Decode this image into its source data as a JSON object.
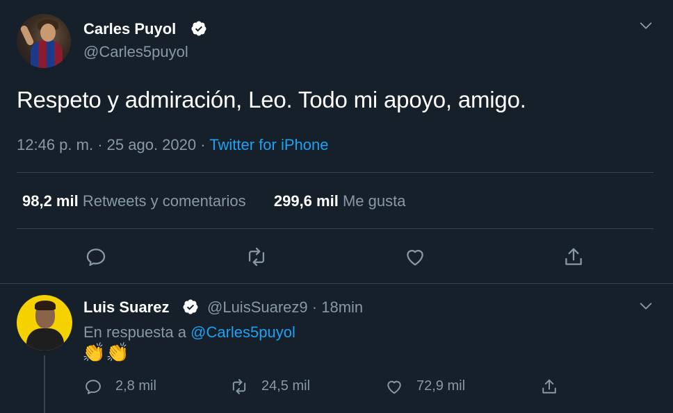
{
  "main_tweet": {
    "author_name": "Carles Puyol",
    "author_handle": "@Carles5puyol",
    "text": "Respeto y admiración, Leo. Todo mi apoyo, amigo.",
    "time": "12:46 p. m.",
    "separator": "·",
    "date": "25 ago. 2020",
    "source": "Twitter for iPhone",
    "retweets_count": "98,2 mil",
    "retweets_label": "Retweets y comentarios",
    "likes_count": "299,6 mil",
    "likes_label": "Me gusta"
  },
  "reply_tweet": {
    "author_name": "Luis Suarez",
    "author_handle": "@LuisSuarez9",
    "separator": "·",
    "time": "18min",
    "replying_prefix": "En respuesta a",
    "replying_to": "@Carles5puyol",
    "emoji_1": "👏",
    "emoji_2": "👏",
    "replies_count": "2,8 mil",
    "retweets_count": "24,5 mil",
    "likes_count": "72,9 mil"
  },
  "icons": {
    "verified": "verified-badge-icon",
    "menu": "chevron-down-icon",
    "reply": "speech-bubble-icon",
    "retweet": "retweet-arrows-icon",
    "like": "heart-icon",
    "share": "share-upload-icon"
  },
  "colors": {
    "background": "#15202b",
    "text_primary": "#ffffff",
    "text_secondary": "#8899a6",
    "accent": "#1da1f2",
    "divider": "#38444d",
    "verified_badge": "#ffffff"
  }
}
